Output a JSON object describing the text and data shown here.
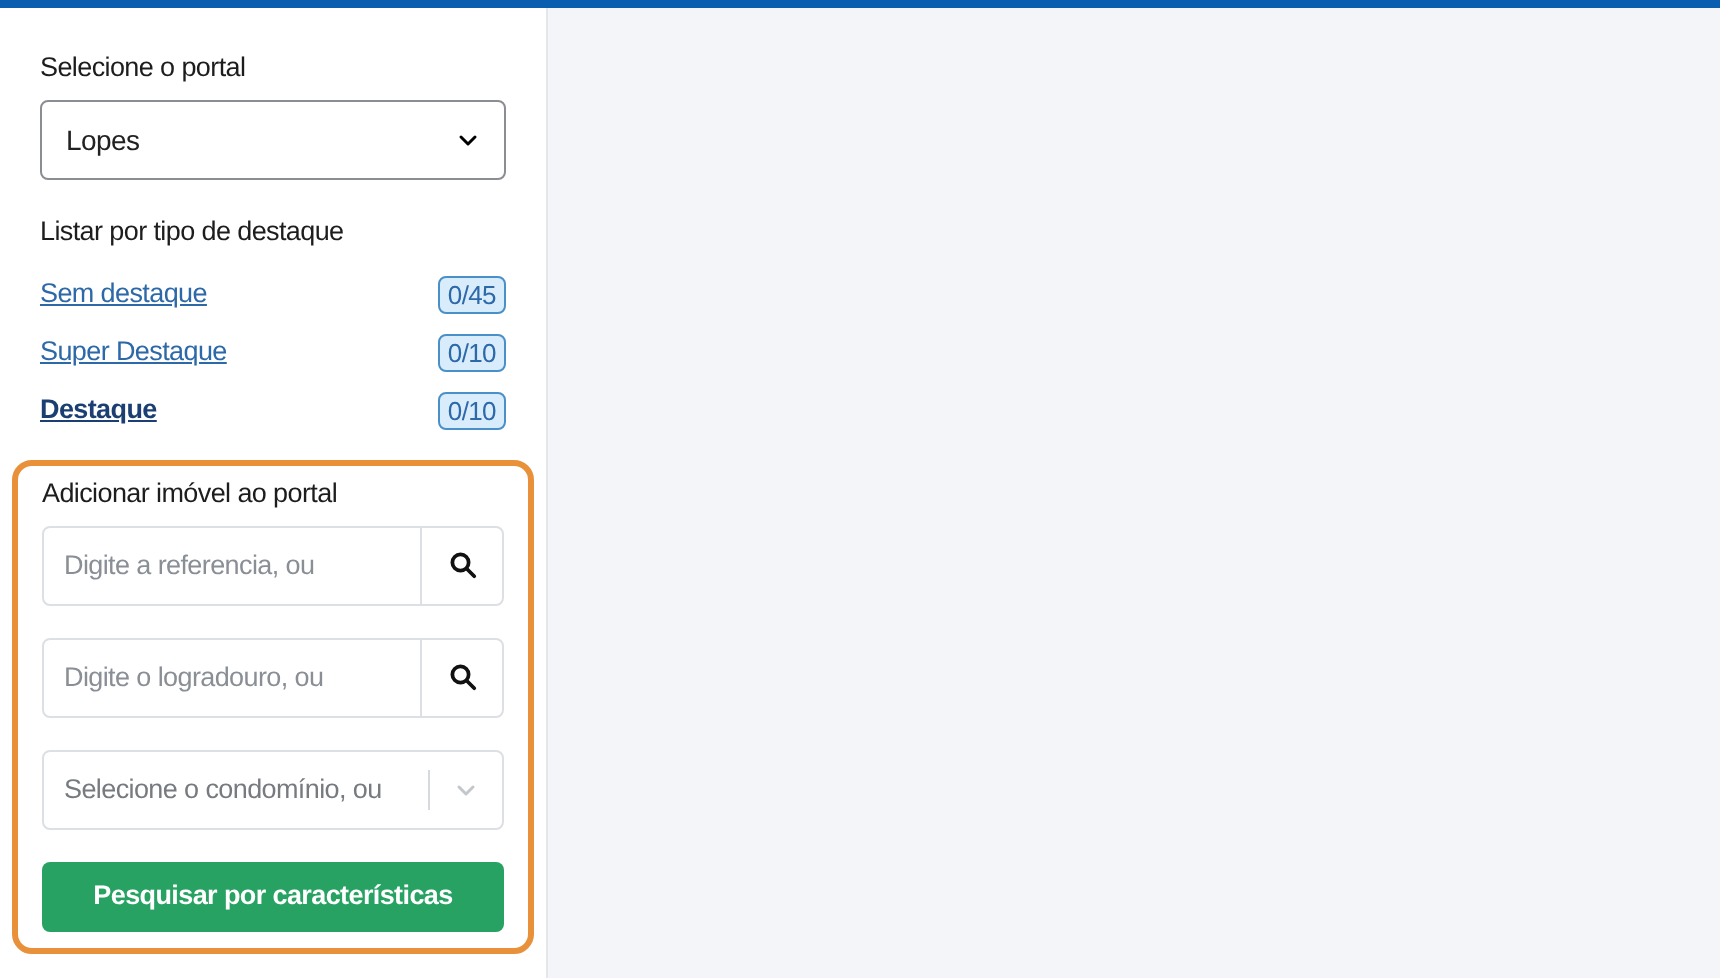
{
  "portal": {
    "label": "Selecione o portal",
    "value": "Lopes"
  },
  "highlights": {
    "title": "Listar por tipo de destaque",
    "items": [
      {
        "label": "Sem destaque",
        "count": "0/45",
        "selected": false
      },
      {
        "label": "Super Destaque",
        "count": "0/10",
        "selected": false
      },
      {
        "label": "Destaque",
        "count": "0/10",
        "selected": true
      }
    ]
  },
  "add_property": {
    "title": "Adicionar imóvel ao portal",
    "highlighted": true,
    "fields": [
      {
        "kind": "search",
        "placeholder": "Digite a referencia, ou"
      },
      {
        "kind": "search",
        "placeholder": "Digite o logradouro, ou"
      },
      {
        "kind": "select",
        "placeholder": "Selecione o condomínio, ou"
      }
    ],
    "button": "Pesquisar por características"
  }
}
